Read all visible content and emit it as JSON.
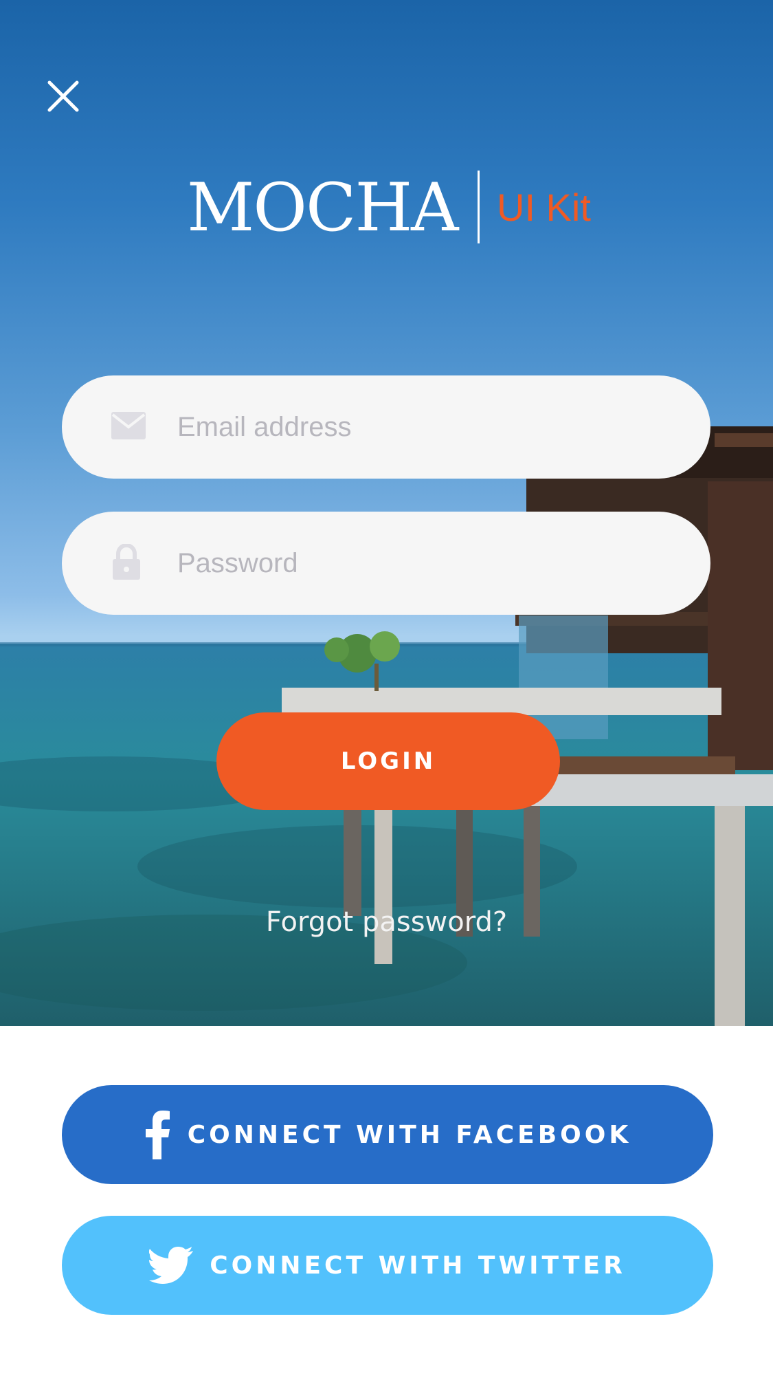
{
  "app": {
    "logo_word": "MOCHA",
    "logo_sub": "UI Kit",
    "brand_color": "#f05a24"
  },
  "header": {
    "close_icon": "close-icon"
  },
  "form": {
    "email": {
      "placeholder": "Email address",
      "value": "",
      "icon": "envelope-icon"
    },
    "password": {
      "placeholder": "Password",
      "value": "",
      "icon": "lock-icon"
    },
    "login_label": "LOGIN",
    "forgot_label": "Forgot password?"
  },
  "social": {
    "facebook": {
      "label": "CONNECT WITH FACEBOOK",
      "icon": "facebook-icon",
      "color": "#276dc8"
    },
    "twitter": {
      "label": "CONNECT WITH TWITTER",
      "icon": "twitter-icon",
      "color": "#52c1fc"
    }
  }
}
